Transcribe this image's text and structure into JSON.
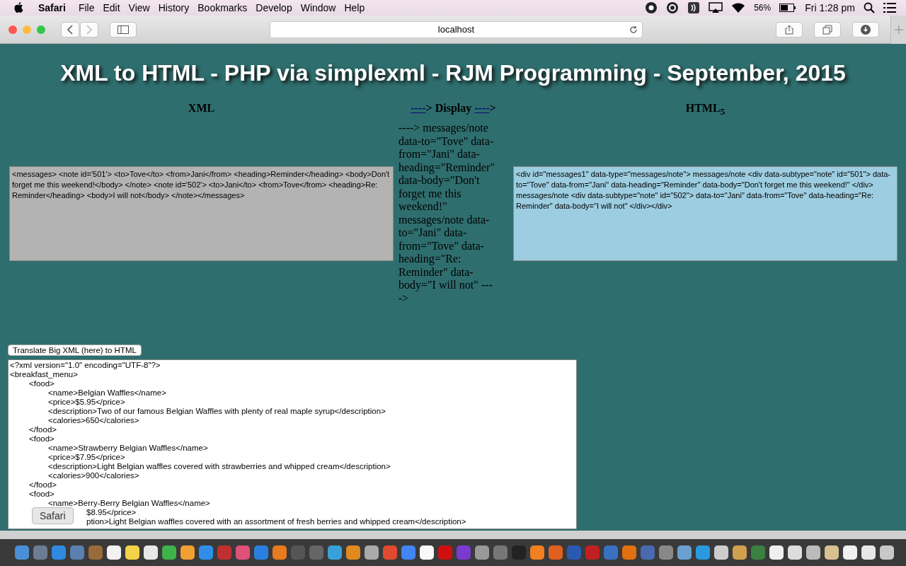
{
  "menu_bar": {
    "app": "Safari",
    "items": [
      "File",
      "Edit",
      "View",
      "History",
      "Bookmarks",
      "Develop",
      "Window",
      "Help"
    ],
    "battery": "56%",
    "clock": "Fri 1:28 pm"
  },
  "toolbar": {
    "address": "localhost"
  },
  "page": {
    "title": "XML to HTML - PHP via simplexml - RJM Programming - September, 2015",
    "xml_heading": "XML",
    "display_heading": [
      {
        "kind": "link",
        "text": "----"
      },
      {
        "kind": "plain",
        "text": "> Display "
      },
      {
        "kind": "link",
        "text": "----"
      },
      {
        "kind": "plain",
        "text": ">"
      }
    ],
    "html_heading": "HTML$_{5}$",
    "xml_value": "<messages>  <note id='501'>    <to>Tove</to>    <from>Jani</from>    <heading>Reminder</heading>    <body>Don't forget me this weekend!</body>  </note>  <note id='502'>    <to>Jani</to>    <from>Tove</from>    <heading>Re: Reminder</heading>    <body>I will not</body>  </note></messages>",
    "display_text": "----> messages/note data-to=\"Tove\" data-from=\"Jani\" data-heading=\"Reminder\" data-body=\"Don't forget me this weekend!\" messages/note data-to=\"Jani\" data-from=\"Tove\" data-heading=\"Re: Reminder\" data-body=\"I will not\" ---->",
    "html_value": "<div id=\"messages1\" data-type=\"messages/note\"> messages/note <div data-subtype=\"note\" id=\"501\"> data-to=\"Tove\" data-from=\"Jani\" data-heading=\"Reminder\" data-body=\"Don't forget me this weekend!\"  </div> messages/note <div data-subtype=\"note\" id=\"502\"> data-to=\"Jani\" data-from=\"Tove\" data-heading=\"Re: Reminder\" data-body=\"I will not\"  </div></div>",
    "translate_button": "Translate Big XML (here) to HTML",
    "big_xml_lines": [
      "<?xml version=\"1.0\" encoding=\"UTF-8\"?>",
      "<breakfast_menu>",
      "\t<food>",
      "\t\t<name>Belgian Waffles</name>",
      "\t\t<price>$5.95</price>",
      "\t\t<description>Two of our famous Belgian Waffles with plenty of real maple syrup</description>",
      "\t\t<calories>650</calories>",
      "\t</food>",
      "\t<food>",
      "\t\t<name>Strawberry Belgian Waffles</name>",
      "\t\t<price>$7.95</price>",
      "\t\t<description>Light Belgian waffles covered with strawberries and whipped cream</description>",
      "\t\t<calories>900</calories>",
      "\t</food>",
      "\t<food>",
      "\t\t<name>Berry-Berry Belgian Waffles</name>",
      "\t\t\t\t$8.95</price>",
      "\t\t\t\tption>Light Belgian waffles covered with an assortment of fresh berries and whipped cream</description>"
    ]
  },
  "dock_tooltip": "Safari"
}
